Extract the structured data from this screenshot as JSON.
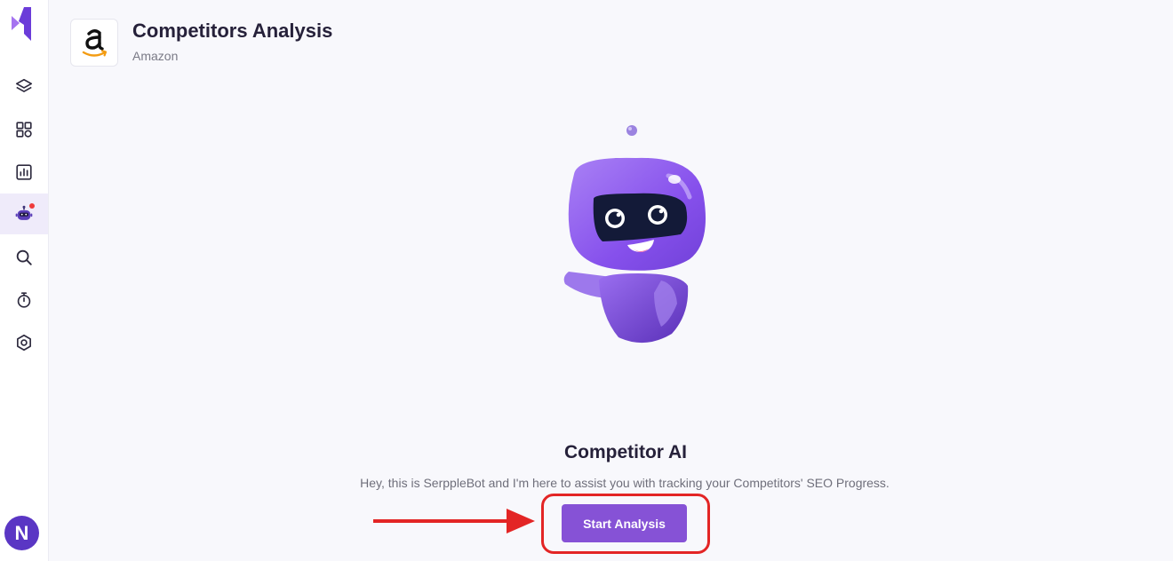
{
  "header": {
    "title": "Competitors Analysis",
    "subtitle": "Amazon",
    "logo_icon": "amazon-logo"
  },
  "sidebar": {
    "items": [
      {
        "name": "layers",
        "icon": "layers-icon"
      },
      {
        "name": "dashboard",
        "icon": "grid-icon"
      },
      {
        "name": "reports",
        "icon": "chart-icon"
      },
      {
        "name": "competitor-ai",
        "icon": "robot-icon",
        "active": true,
        "has_notification": true
      },
      {
        "name": "search",
        "icon": "search-icon"
      },
      {
        "name": "timer",
        "icon": "stopwatch-icon"
      },
      {
        "name": "settings",
        "icon": "settings-icon"
      }
    ],
    "avatar_initial": "N"
  },
  "main": {
    "heading": "Competitor AI",
    "description": "Hey, this is SerppleBot and I'm here to assist you with tracking your Competitors' SEO Progress.",
    "button_label": "Start Analysis"
  },
  "colors": {
    "accent": "#8652d6",
    "avatar": "#5a36c4",
    "annotation": "#e32525",
    "title": "#26213a"
  }
}
